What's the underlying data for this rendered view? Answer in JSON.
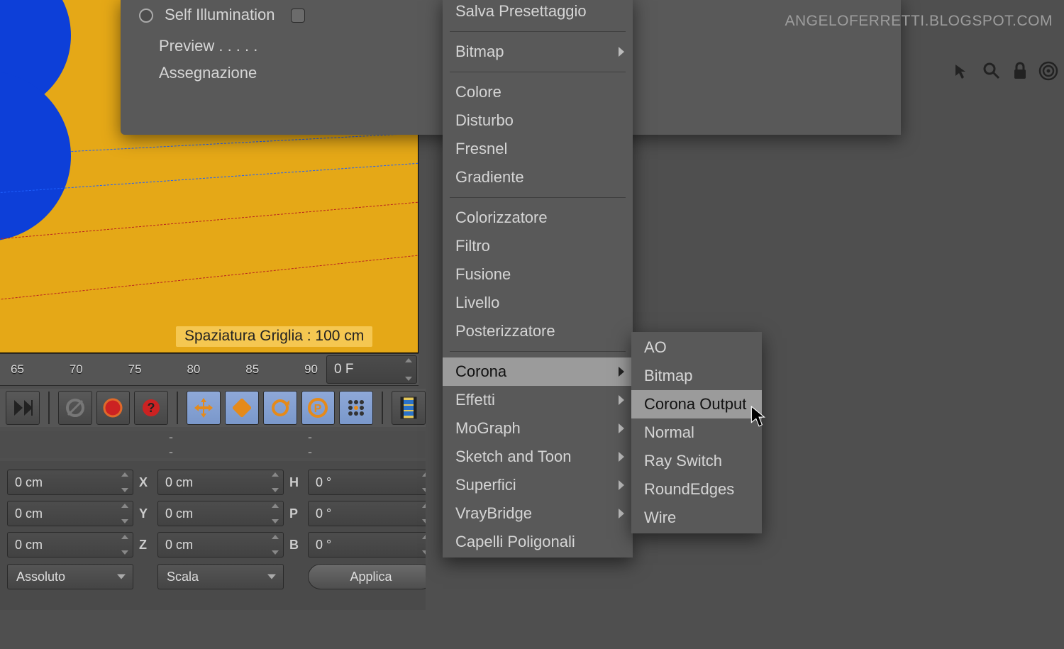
{
  "watermark": "ANGELOFERRETTI.BLOGSPOT.COM",
  "viewport": {
    "grid_label": "Spaziatura Griglia : 100 cm"
  },
  "timeline": {
    "ticks": [
      "65",
      "70",
      "75",
      "80",
      "85",
      "90"
    ],
    "current_frame": "0 F"
  },
  "toolbar_icons": {
    "skip_end": "skip-end",
    "record_off": "record-disabled",
    "record_red": "record",
    "help": "help",
    "move": "move",
    "scale": "scale",
    "rotate": "rotate",
    "params": "parameters",
    "grid": "grid",
    "film": "filmstrip"
  },
  "status_bar": {
    "col1": "--",
    "col2": "--",
    "col3": "--"
  },
  "coords": {
    "x": "0 cm",
    "y": "0 cm",
    "z": "0 cm",
    "sx": "0 cm",
    "sy": "0 cm",
    "sz": "0 cm",
    "h": "0 °",
    "p": "0 °",
    "b": "0 °",
    "lbl_x": "X",
    "lbl_y": "Y",
    "lbl_z": "Z",
    "lbl_h": "H",
    "lbl_p": "P",
    "lbl_b": "B",
    "mode_left": "Assoluto",
    "mode_mid": "Scala",
    "apply": "Applica"
  },
  "mat_panel": {
    "self_illum_label": "Self Illumination",
    "preview_label": "Preview . . . . .",
    "assign_label": "Assegnazione"
  },
  "menu1": {
    "items": [
      {
        "label": "Salva Presettaggio",
        "sep_after": true
      },
      {
        "label": "Bitmap",
        "sub": true,
        "sep_after": true
      },
      {
        "label": "Colore"
      },
      {
        "label": "Disturbo"
      },
      {
        "label": "Fresnel"
      },
      {
        "label": "Gradiente",
        "sep_after": true
      },
      {
        "label": "Colorizzatore"
      },
      {
        "label": "Filtro"
      },
      {
        "label": "Fusione"
      },
      {
        "label": "Livello"
      },
      {
        "label": "Posterizzatore",
        "sep_after": true
      },
      {
        "label": "Corona",
        "sub": true,
        "hover": true
      },
      {
        "label": "Effetti",
        "sub": true
      },
      {
        "label": "MoGraph",
        "sub": true
      },
      {
        "label": "Sketch and Toon",
        "sub": true
      },
      {
        "label": "Superfici",
        "sub": true
      },
      {
        "label": "VrayBridge",
        "sub": true
      },
      {
        "label": "Capelli Poligonali"
      }
    ]
  },
  "menu2": {
    "items": [
      {
        "label": "AO"
      },
      {
        "label": "Bitmap"
      },
      {
        "label": "Corona Output",
        "hover": true
      },
      {
        "label": "Normal"
      },
      {
        "label": "Ray Switch"
      },
      {
        "label": "RoundEdges"
      },
      {
        "label": "Wire"
      }
    ]
  }
}
